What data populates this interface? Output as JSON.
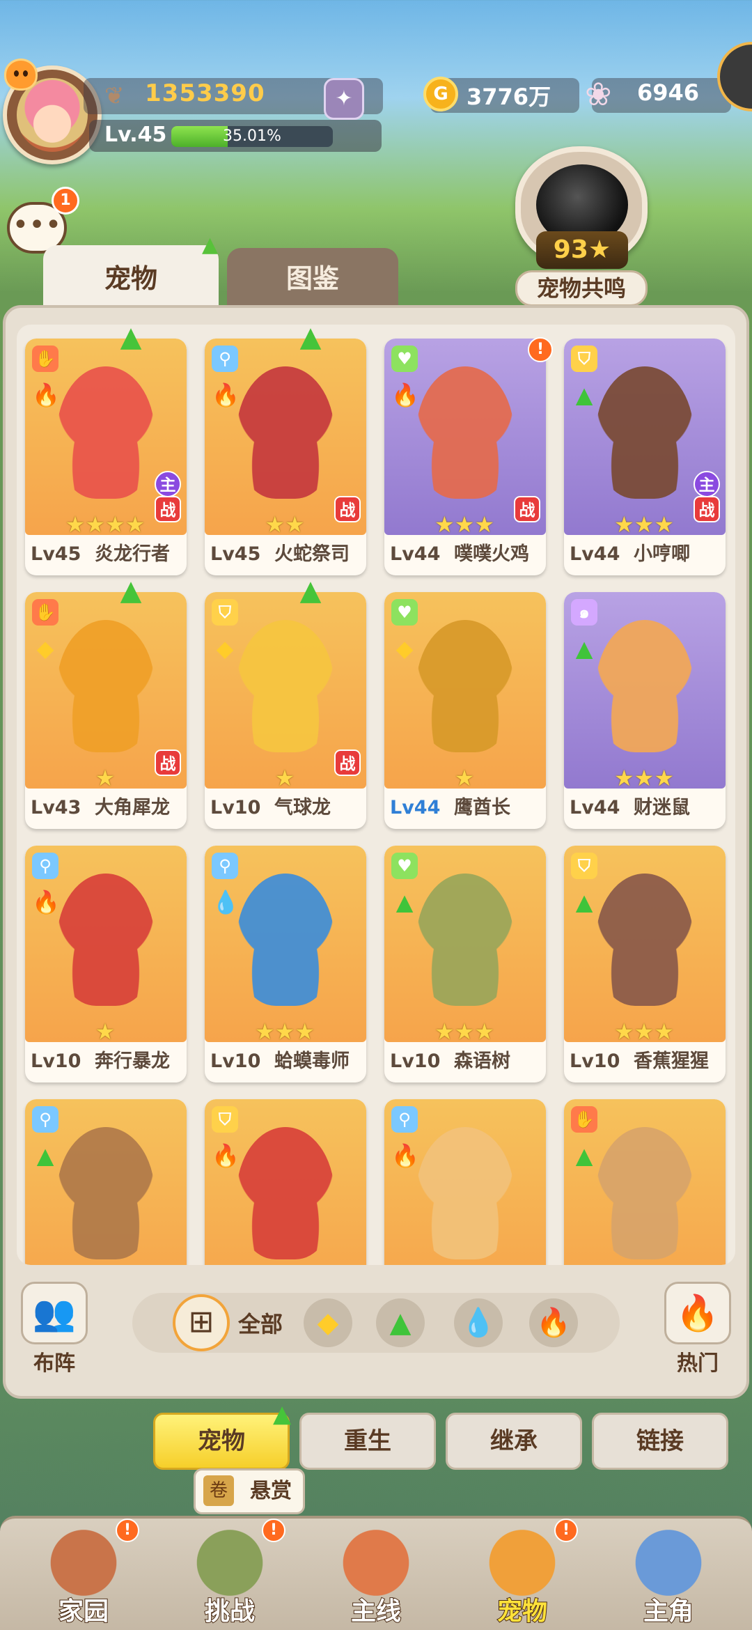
{
  "player": {
    "power": "1353390",
    "level": "Lv.45",
    "xp_percent_text": "35.01%",
    "xp_fraction": 0.3501,
    "gold": "3776万",
    "gems": "6946",
    "chat_badge": "1"
  },
  "resonance": {
    "count": "93",
    "label": "宠物共鸣"
  },
  "tabs": {
    "pets": "宠物",
    "codex": "图鉴"
  },
  "pets": [
    {
      "level": "Lv45",
      "name": "炎龙行者",
      "stars": "★★★★",
      "role": "fire",
      "role_bg": "red",
      "element": "fire",
      "main": "主",
      "battle": "战",
      "art": "orange",
      "upgrade": true,
      "alert": false,
      "color": "#e9544b"
    },
    {
      "level": "Lv45",
      "name": "火蛇祭司",
      "stars": "★★",
      "role": "key",
      "role_bg": "blue",
      "element": "fire",
      "main": "",
      "battle": "战",
      "art": "orange",
      "upgrade": true,
      "alert": false,
      "color": "#c63a3e"
    },
    {
      "level": "Lv44",
      "name": "噗噗火鸡",
      "stars": "★★★",
      "role": "heart",
      "role_bg": "green",
      "element": "fire",
      "main": "",
      "battle": "战",
      "art": "purple",
      "upgrade": false,
      "alert": true,
      "color": "#e56b4d"
    },
    {
      "level": "Lv44",
      "name": "小哼唧",
      "stars": "★★★",
      "role": "shield",
      "role_bg": "gold",
      "element": "grass",
      "main": "主",
      "battle": "战",
      "art": "purple",
      "upgrade": false,
      "alert": false,
      "color": "#7a4a34"
    },
    {
      "level": "Lv43",
      "name": "大角犀龙",
      "stars": "★",
      "role": "fire",
      "role_bg": "red",
      "element": "earth",
      "main": "",
      "battle": "战",
      "art": "orange",
      "upgrade": true,
      "alert": false,
      "color": "#f0a028"
    },
    {
      "level": "Lv10",
      "name": "气球龙",
      "stars": "★",
      "role": "shield",
      "role_bg": "gold",
      "element": "earth",
      "main": "",
      "battle": "战",
      "art": "orange",
      "upgrade": true,
      "alert": false,
      "color": "#f6c640"
    },
    {
      "level": "Lv44",
      "name": "鹰酋长",
      "stars": "★",
      "role": "heart",
      "role_bg": "green",
      "element": "earth",
      "main": "",
      "battle": "",
      "art": "orange",
      "upgrade": false,
      "alert": false,
      "color": "#d89a2a",
      "blue": true
    },
    {
      "level": "Lv44",
      "name": "财迷鼠",
      "stars": "★★★",
      "role": "spiral",
      "role_bg": "lilac",
      "element": "grass",
      "main": "",
      "battle": "",
      "art": "purple",
      "upgrade": false,
      "alert": false,
      "color": "#f3a856"
    },
    {
      "level": "Lv10",
      "name": "奔行暴龙",
      "stars": "★",
      "role": "key",
      "role_bg": "blue",
      "element": "fire",
      "main": "",
      "battle": "",
      "art": "orange",
      "upgrade": false,
      "alert": false,
      "color": "#d8423a"
    },
    {
      "level": "Lv10",
      "name": "蛤蟆毒师",
      "stars": "★★★",
      "role": "key",
      "role_bg": "blue",
      "element": "water",
      "main": "",
      "battle": "",
      "art": "orange",
      "upgrade": false,
      "alert": false,
      "color": "#3f8ed8"
    },
    {
      "level": "Lv10",
      "name": "森语树",
      "stars": "★★★",
      "role": "heart",
      "role_bg": "green",
      "element": "grass",
      "main": "",
      "battle": "",
      "art": "orange",
      "upgrade": false,
      "alert": false,
      "color": "#9aa65a"
    },
    {
      "level": "Lv10",
      "name": "香蕉猩猩",
      "stars": "★★★",
      "role": "shield",
      "role_bg": "gold",
      "element": "grass",
      "main": "",
      "battle": "",
      "art": "orange",
      "upgrade": false,
      "alert": false,
      "color": "#8a5a4a"
    },
    {
      "level": "",
      "name": "",
      "stars": "",
      "role": "key",
      "role_bg": "blue",
      "element": "grass",
      "main": "",
      "battle": "",
      "art": "orange",
      "upgrade": false,
      "alert": false,
      "color": "#b07a4a"
    },
    {
      "level": "",
      "name": "",
      "stars": "",
      "role": "shield",
      "role_bg": "gold",
      "element": "fire",
      "main": "",
      "battle": "",
      "art": "orange",
      "upgrade": false,
      "alert": false,
      "color": "#d8423a"
    },
    {
      "level": "",
      "name": "",
      "stars": "",
      "role": "key",
      "role_bg": "blue",
      "element": "fire",
      "main": "",
      "battle": "",
      "art": "orange",
      "upgrade": false,
      "alert": false,
      "color": "#f2c27a"
    },
    {
      "level": "",
      "name": "",
      "stars": "",
      "role": "fire",
      "role_bg": "red",
      "element": "grass",
      "main": "",
      "battle": "",
      "art": "orange",
      "upgrade": false,
      "alert": false,
      "color": "#d8a46a"
    }
  ],
  "filters": {
    "formation": "布阵",
    "all": "全部",
    "hot": "热门"
  },
  "subtabs": [
    "宠物",
    "重生",
    "继承",
    "链接"
  ],
  "bounty": "悬赏",
  "nav": [
    {
      "label": "家园",
      "alert": true
    },
    {
      "label": "挑战",
      "alert": true
    },
    {
      "label": "主线",
      "alert": false
    },
    {
      "label": "宠物",
      "alert": true,
      "active": true
    },
    {
      "label": "主角",
      "alert": false
    }
  ],
  "colors": {
    "accent_gold": "#ffcc4a",
    "upgrade_green": "#46c43a",
    "battle_red": "#e83b3b",
    "alert_orange": "#ff6a1f"
  }
}
